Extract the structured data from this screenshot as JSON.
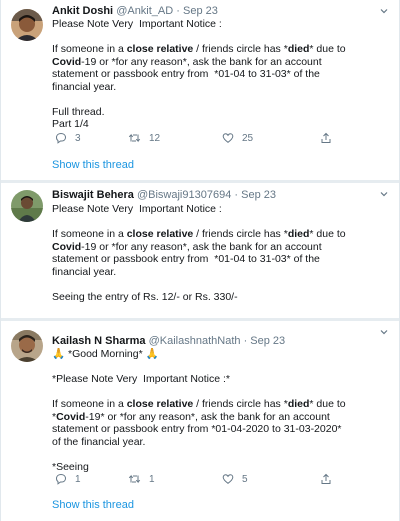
{
  "tweets": [
    {
      "name": "Ankit Doshi",
      "handle": "@Ankit_AD",
      "sep": "·",
      "date": "Sep 23",
      "lines": [
        "Please Note Very  Important Notice :",
        "",
        [
          "If someone in a ",
          {
            "b": "close relative"
          },
          " / friends circle has *",
          {
            "b": "died"
          },
          "* due to"
        ],
        [
          {
            "b": "Covid"
          },
          "-19 or *for any reason*, ask the bank for an account"
        ],
        "statement or passbook entry from  *01-04 to 31-03* of the",
        "financial year.",
        "",
        "Full thread.",
        "Part 1/4"
      ],
      "replies": "3",
      "retweets": "12",
      "likes": "25",
      "show_thread": "Show this thread"
    },
    {
      "name": "Biswajit Behera",
      "handle": "@Biswaji91307694",
      "sep": "·",
      "date": "Sep 23",
      "lines": [
        "Please Note Very  Important Notice :",
        "",
        [
          "If someone in a ",
          {
            "b": "close relative"
          },
          " / friends circle has *",
          {
            "b": "died"
          },
          "* due to"
        ],
        [
          {
            "b": "Covid"
          },
          "-19 or *for any reason*, ask the bank for an account"
        ],
        "statement or passbook entry from  *01-04 to 31-03* of the",
        "financial year.",
        "",
        "Seeing the entry of Rs. 12/- or Rs. 330/-"
      ]
    },
    {
      "name": "Kailash N Sharma",
      "handle": "@KailashnathNath",
      "sep": "·",
      "date": "Sep 23",
      "lines": [
        "🙏 *Good Morning* 🙏",
        "",
        "*Please Note Very  Important Notice :*",
        "",
        [
          "If someone in a ",
          {
            "b": "close relative"
          },
          " / friends circle has *",
          {
            "b": "died"
          },
          "* due to"
        ],
        [
          "*",
          {
            "b": "Covid"
          },
          "-19* or *for any reason*, ask the bank for an account"
        ],
        "statement or passbook entry from *01-04-2020 to 31-03-2020*",
        "of the financial year.",
        "",
        "*Seeing"
      ],
      "replies": "1",
      "retweets": "1",
      "likes": "5",
      "show_thread": "Show this thread"
    }
  ],
  "icons": {
    "reply": "reply-icon",
    "retweet": "retweet-icon",
    "like": "heart-icon",
    "share": "share-icon",
    "caret": "chevron-down-icon"
  },
  "colors": {
    "link": "#1b95e0",
    "muted": "#657786",
    "text": "#14171a",
    "divider": "#e6ecf0"
  }
}
